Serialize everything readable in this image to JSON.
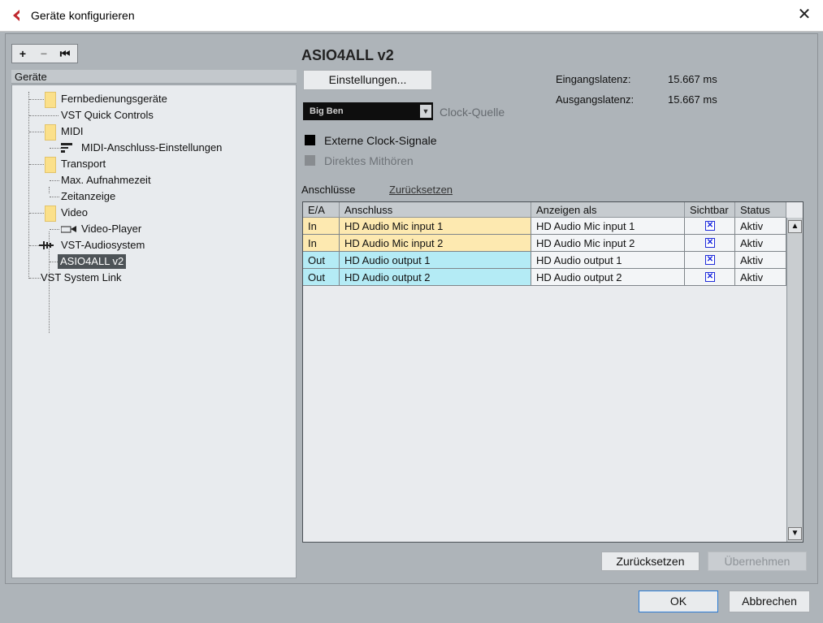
{
  "window": {
    "title": "Geräte konfigurieren",
    "close_glyph": "✕",
    "icon_color": "#c0282e"
  },
  "toolbar": {
    "add": "+",
    "remove": "−",
    "reset": "⏮"
  },
  "tree": {
    "header": "Geräte",
    "items": {
      "remote": "Fernbedienungsgeräte",
      "vst_quick": "VST Quick Controls",
      "midi": "MIDI",
      "midi_port": "MIDI-Anschluss-Einstellungen",
      "transport": "Transport",
      "max_rec": "Max. Aufnahmezeit",
      "time_display": "Zeitanzeige",
      "video": "Video",
      "video_player": "Video-Player",
      "vst_audio": "VST-Audiosystem",
      "asio": "ASIO4ALL v2",
      "vst_link": "VST System Link"
    }
  },
  "device": {
    "name": "ASIO4ALL v2",
    "settings_button": "Einstellungen...",
    "clock_value": "Big Ben",
    "clock_label": "Clock-Quelle",
    "external_clock": "Externe Clock-Signale",
    "direct_monitor": "Direktes Mithören",
    "input_latency_label": "Eingangslatenz:",
    "input_latency_value": "15.667 ms",
    "output_latency_label": "Ausgangslatenz:",
    "output_latency_value": "15.667 ms"
  },
  "ports": {
    "label": "Anschlüsse",
    "reset_link": "Zurücksetzen",
    "columns": [
      "E/A",
      "Anschluss",
      "Anzeigen als",
      "Sichtbar",
      "Status"
    ],
    "rows": [
      {
        "io": "In",
        "port": "HD Audio Mic input 1",
        "display": "HD Audio Mic input 1",
        "visible": "✕",
        "status": "Aktiv"
      },
      {
        "io": "In",
        "port": "HD Audio Mic input 2",
        "display": "HD Audio Mic input 2",
        "visible": "✕",
        "status": "Aktiv"
      },
      {
        "io": "Out",
        "port": "HD Audio output 1",
        "display": "HD Audio output 1",
        "visible": "✕",
        "status": "Aktiv"
      },
      {
        "io": "Out",
        "port": "HD Audio output 2",
        "display": "HD Audio output 2",
        "visible": "✕",
        "status": "Aktiv"
      }
    ]
  },
  "buttons": {
    "reset": "Zurücksetzen",
    "apply": "Übernehmen",
    "ok": "OK",
    "cancel": "Abbrechen"
  }
}
